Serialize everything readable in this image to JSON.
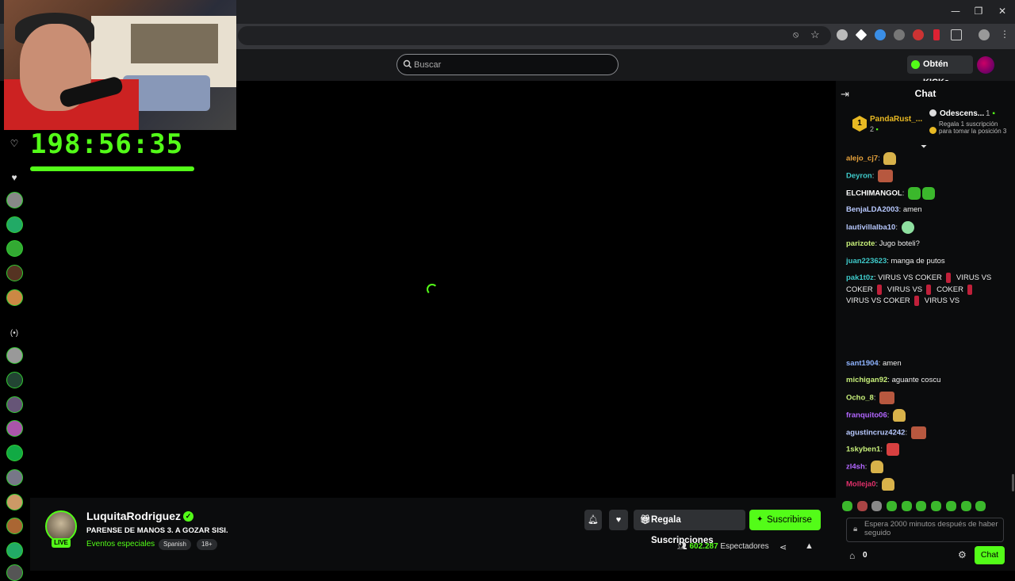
{
  "browser": {
    "window_controls": [
      "—",
      "❐",
      "✕"
    ]
  },
  "header": {
    "search_placeholder": "Buscar",
    "get_kicks_label": "Obtén KICKs"
  },
  "stream": {
    "timer": "198:56:35",
    "timer_progress": 1.0
  },
  "channel": {
    "name": "LuquitaRodriguez",
    "live_label": "LIVE",
    "title": "PARENSE DE MANOS 3. A GOZAR SISI.",
    "category": "Eventos especiales",
    "tags": [
      "Spanish",
      "18+"
    ],
    "gift_subs_label": "Regala Suscripciones",
    "subscribe_label": "Suscribirse",
    "viewers_count": "602.287",
    "viewers_label": "Espectadores"
  },
  "chat": {
    "title": "Chat",
    "pinned": {
      "rank": "1",
      "user": "PandaRust_...",
      "count": "2",
      "gift_user": "Odescens...",
      "gift_count": "1",
      "gift_desc": "Regala 1 suscripción para tomar la posición 3"
    },
    "messages": [
      {
        "user": "alejo_cj7",
        "color": "#e8a33c",
        "text": "",
        "emotes": [
          "clap"
        ]
      },
      {
        "user": "Deyron",
        "color": "#3ec9c9",
        "text": "",
        "emotes": [
          "face"
        ]
      },
      {
        "user": "ELCHIMANGOL",
        "color": "#ffffff",
        "text": "",
        "emotes": [
          "green",
          "green"
        ]
      },
      {
        "user": "BenjaLDA2003",
        "color": "#b8c9ff",
        "text": "amen",
        "emotes": []
      },
      {
        "user": "lautivillalba10",
        "color": "#b8c9ff",
        "text": "",
        "emotes": [
          "alien"
        ]
      },
      {
        "user": "parizote",
        "color": "#c8f07a",
        "text": "Jugo boteli?",
        "emotes": []
      },
      {
        "user": "juan223623",
        "color": "#3ec9c9",
        "text": "manga de putos",
        "emotes": []
      },
      {
        "user": "pak1t0z",
        "color": "#3ec9c9",
        "text": "VIRUS VS COKER",
        "emotes": []
      },
      {
        "user": "sant1904",
        "color": "#8fb4ff",
        "text": "amen",
        "emotes": []
      },
      {
        "user": "michigan92",
        "color": "#c8f07a",
        "text": "aguante coscu",
        "emotes": []
      },
      {
        "user": "Ocho_8",
        "color": "#c8f07a",
        "text": "",
        "emotes": [
          "face"
        ]
      },
      {
        "user": "franquito06",
        "color": "#b266ff",
        "text": "",
        "emotes": [
          "clap"
        ]
      },
      {
        "user": "agustincruz4242",
        "color": "#b8c9ff",
        "text": "",
        "emotes": [
          "face"
        ]
      },
      {
        "user": "1skyben1",
        "color": "#c8f07a",
        "text": "",
        "emotes": [
          "red"
        ]
      },
      {
        "user": "zl4sh",
        "color": "#b266ff",
        "text": "",
        "emotes": [
          "clap"
        ]
      },
      {
        "user": "Molleja0",
        "color": "#e0306a",
        "text": "",
        "emotes": [
          "clap"
        ]
      }
    ],
    "spam_lines": [
      "VIRUS VS COKER",
      "VIRUS VS",
      "COKER",
      "VIRUS VS COKER",
      "VIRUS VS"
    ],
    "input_placeholder": "Espera 2000 minutos después de haber seguido",
    "points": "0",
    "send_label": "Chat"
  },
  "colors": {
    "accent": "#53fc18",
    "background": "#000000",
    "panel": "#0b0c0d"
  }
}
